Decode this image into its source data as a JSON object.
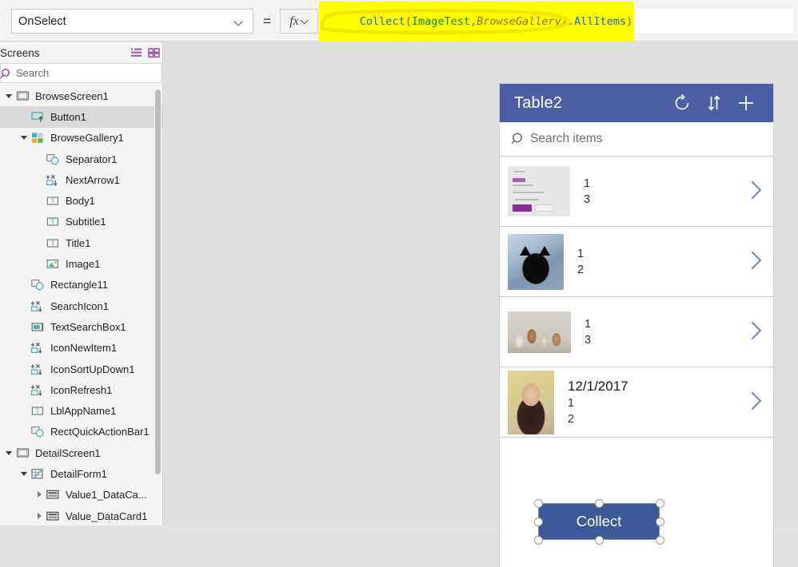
{
  "formula_bar": {
    "property_selected": "OnSelect",
    "equals": "=",
    "fx_label": "fx",
    "formula_full": "Collect(ImageTest,BrowseGallery1.AllItems)",
    "tokens": {
      "fn": "Collect",
      "open_paren": "(",
      "table": "ImageTest",
      "comma": ",",
      "control": "BrowseGallery1",
      "property": ".AllItems",
      "close_paren": ")"
    },
    "highlight_color": "#ffff00"
  },
  "tree_panel": {
    "title": "Screens",
    "search_placeholder": "Search",
    "view_icons": [
      "list-view-icon",
      "grid-view-icon"
    ],
    "accent_color": "#8a3f99",
    "items": [
      {
        "label": "BrowseScreen1",
        "indent": 0,
        "caret": "down",
        "icon": "screen-icon",
        "selected": false
      },
      {
        "label": "Button1",
        "indent": 1,
        "caret": "none",
        "icon": "button-icon",
        "selected": true
      },
      {
        "label": "BrowseGallery1",
        "indent": 1,
        "caret": "down",
        "icon": "gallery-icon",
        "selected": false
      },
      {
        "label": "Separator1",
        "indent": 2,
        "caret": "none",
        "icon": "shape-icon",
        "selected": false
      },
      {
        "label": "NextArrow1",
        "indent": 2,
        "caret": "none",
        "icon": "icon-icon",
        "selected": false
      },
      {
        "label": "Body1",
        "indent": 2,
        "caret": "none",
        "icon": "label-icon",
        "selected": false
      },
      {
        "label": "Subtitle1",
        "indent": 2,
        "caret": "none",
        "icon": "label-icon",
        "selected": false
      },
      {
        "label": "Title1",
        "indent": 2,
        "caret": "none",
        "icon": "label-icon",
        "selected": false
      },
      {
        "label": "Image1",
        "indent": 2,
        "caret": "none",
        "icon": "image-icon",
        "selected": false
      },
      {
        "label": "Rectangle11",
        "indent": 1,
        "caret": "none",
        "icon": "shape-icon",
        "selected": false
      },
      {
        "label": "SearchIcon1",
        "indent": 1,
        "caret": "none",
        "icon": "icon-icon",
        "selected": false
      },
      {
        "label": "TextSearchBox1",
        "indent": 1,
        "caret": "none",
        "icon": "textinput-icon",
        "selected": false
      },
      {
        "label": "IconNewItem1",
        "indent": 1,
        "caret": "none",
        "icon": "icon-icon",
        "selected": false
      },
      {
        "label": "IconSortUpDown1",
        "indent": 1,
        "caret": "none",
        "icon": "icon-icon",
        "selected": false
      },
      {
        "label": "IconRefresh1",
        "indent": 1,
        "caret": "none",
        "icon": "icon-icon",
        "selected": false
      },
      {
        "label": "LblAppName1",
        "indent": 1,
        "caret": "none",
        "icon": "label-icon",
        "selected": false
      },
      {
        "label": "RectQuickActionBar1",
        "indent": 1,
        "caret": "none",
        "icon": "shape-icon",
        "selected": false
      },
      {
        "label": "DetailScreen1",
        "indent": 0,
        "caret": "down",
        "icon": "screen-icon",
        "selected": false
      },
      {
        "label": "DetailForm1",
        "indent": 1,
        "caret": "down",
        "icon": "form-icon",
        "selected": false
      },
      {
        "label": "Value1_DataCa...",
        "indent": 2,
        "caret": "right",
        "icon": "datacard-icon",
        "selected": false
      },
      {
        "label": "Value_DataCard1",
        "indent": 2,
        "caret": "right",
        "icon": "datacard-icon",
        "selected": false
      }
    ]
  },
  "app_preview": {
    "titlebar": {
      "title": "Table2",
      "background_color": "#4a5fa5",
      "icons": [
        "refresh-icon",
        "sort-icon",
        "add-icon"
      ]
    },
    "search": {
      "placeholder": "Search items",
      "icon": "search-icon"
    },
    "gallery_rows": [
      {
        "title": "",
        "subtitle": "1",
        "body": "3",
        "thumbnail": "screenshot-thumbnail"
      },
      {
        "title": "",
        "subtitle": "1",
        "body": "2",
        "thumbnail": "black-cat-photo"
      },
      {
        "title": "",
        "subtitle": "1",
        "body": "3",
        "thumbnail": "kittens-photo"
      },
      {
        "title": "12/1/2017",
        "subtitle": "1",
        "body": "2",
        "thumbnail": "portrait-photo"
      }
    ],
    "selected_control": {
      "label": "Collect",
      "fill_color": "#3b5998",
      "handles": 8
    }
  }
}
